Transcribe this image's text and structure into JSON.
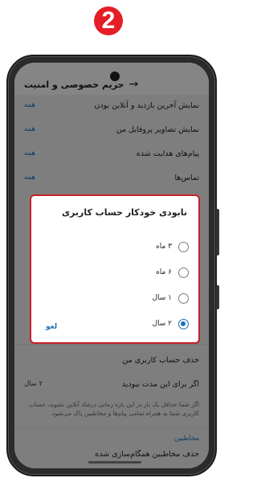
{
  "step_badge": "2",
  "header": {
    "title": "حریم خصوصی و امنیت",
    "back_glyph": "→"
  },
  "background_rows": [
    {
      "label": "نمایش آخرین بازدید و آنلاین بودن",
      "value": "همه"
    },
    {
      "label": "نمایش تصاویر پروفایل من",
      "value": "همه"
    },
    {
      "label": "پیام‌های هدایت شده",
      "value": "همه"
    },
    {
      "label": "تماس‌ها",
      "value": "همه"
    }
  ],
  "delete_section": {
    "delete_account_label": "حذف حساب کاربری من",
    "if_away_label": "اگر برای این مدت نبودید",
    "if_away_value": "۲ سال",
    "info_text": "اگر شما حداقل یک بار در این بازه زمانی درشاد آنلاین نشوید، حساب کاربری شما به همراه تمامی پیام‌ها و مخاطبین پاک می‌شود."
  },
  "contacts_section": {
    "header": "مخاطبین",
    "delete_synced_label": "حذف مخاطبین همگام‌سازی شده"
  },
  "dialog": {
    "title": "نابودی خودکار حساب کاربری",
    "options": [
      {
        "label": "۳ ماه",
        "checked": false
      },
      {
        "label": "۶ ماه",
        "checked": false
      },
      {
        "label": "۱ سال",
        "checked": false
      },
      {
        "label": "۲ سال",
        "checked": true
      }
    ],
    "cancel_label": "لغو"
  },
  "colors": {
    "accent": "#1f6fb5",
    "badge": "#e41e26",
    "highlight_border": "#c9202b"
  }
}
